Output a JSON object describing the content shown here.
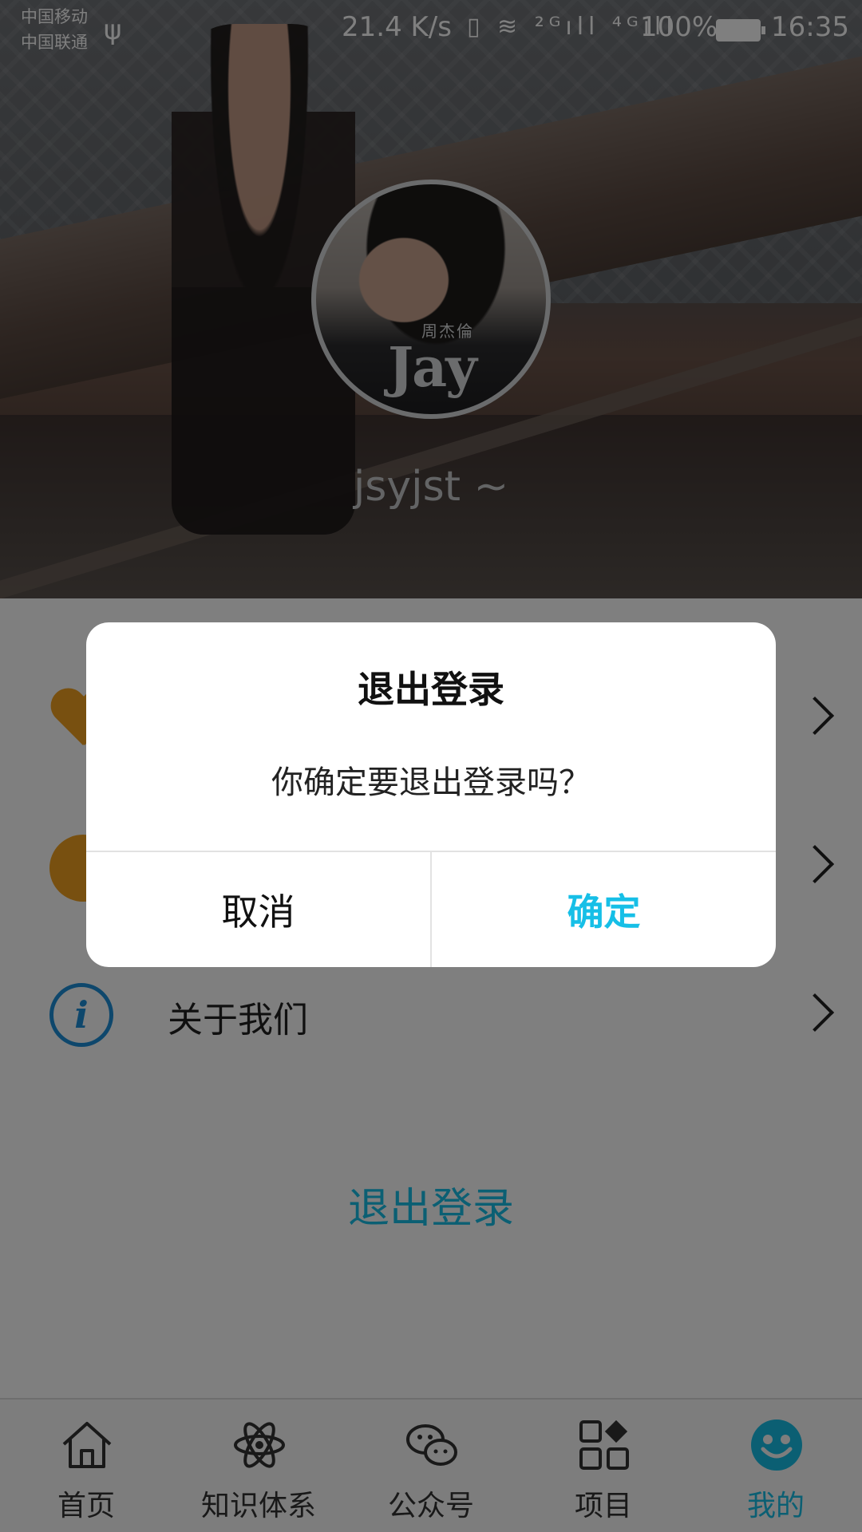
{
  "status_bar": {
    "carrier_1": "中国移动",
    "carrier_2": "中国联通",
    "net_speed": "21.4 K/s",
    "signal_glyphs": "▯ ≋ ²ᴳıll ⁴ᴳıll",
    "battery": "100%",
    "time": "16:35"
  },
  "profile": {
    "username": "jsyjst ~",
    "avatar_text": "Jay",
    "avatar_subtext": "周杰倫"
  },
  "menu": {
    "items": [
      {
        "label": "",
        "icon": "heart-icon"
      },
      {
        "label": "",
        "icon": "gear-icon"
      },
      {
        "label": "关于我们",
        "icon": "info-icon"
      }
    ],
    "logout_label": "退出登录"
  },
  "dialog": {
    "title": "退出登录",
    "message": "你确定要退出登录吗？",
    "cancel": "取消",
    "confirm": "确定"
  },
  "bottom_nav": {
    "items": [
      {
        "label": "首页",
        "icon": "home-icon"
      },
      {
        "label": "知识体系",
        "icon": "atom-icon"
      },
      {
        "label": "公众号",
        "icon": "wechat-icon"
      },
      {
        "label": "项目",
        "icon": "grid-icon"
      },
      {
        "label": "我的",
        "icon": "smile-icon",
        "active": true
      }
    ]
  },
  "colors": {
    "accent": "#16bfe7",
    "info_blue": "#1c8fd9",
    "menu_icon_orange": "#f0a020"
  }
}
